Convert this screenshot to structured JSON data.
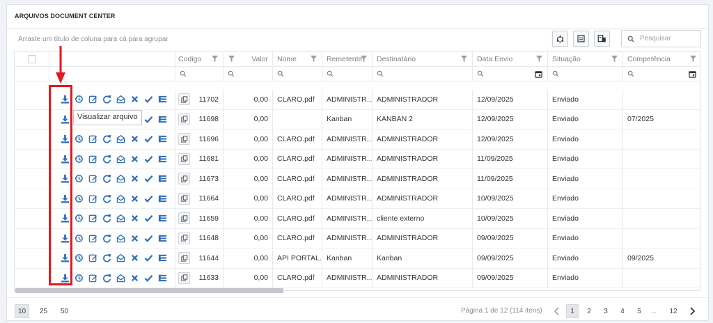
{
  "panel": {
    "title": "ARQUIVOS DOCUMENT CENTER",
    "group_hint": "Arraste um título de coluna para cá para agrupar"
  },
  "toolbar": {
    "buttons": [
      {
        "name": "refresh-icon"
      },
      {
        "name": "export-excel-icon"
      },
      {
        "name": "column-chooser-icon"
      }
    ],
    "search_placeholder": "Pesquisar",
    "search_value": ""
  },
  "columns": {
    "codigo": "Codigo",
    "valor": "Valor",
    "nome": "Nome",
    "remetente": "Remetente",
    "destinatario": "Destinatário",
    "data_envio": "Data Envio",
    "situacao": "Situação",
    "competencia": "Competência"
  },
  "action_icons": [
    "download-icon",
    "history-icon",
    "edit-icon",
    "redo-icon",
    "open-mail-icon",
    "cancel-icon",
    "check-icon",
    "details-list-icon"
  ],
  "rows": [
    {
      "codigo": "11702",
      "valor": "0,00",
      "nome": "CLARO.pdf",
      "remetente": "ADMINISTR...",
      "destinatario": "ADMINISTRADOR",
      "data_envio": "12/09/2025",
      "situacao": "Enviado",
      "competencia": ""
    },
    {
      "codigo": "11698",
      "valor": "0,00",
      "nome": "",
      "remetente": "Kanban",
      "destinatario": "KANBAN 2",
      "data_envio": "12/09/2025",
      "situacao": "Enviado",
      "competencia": "07/2025"
    },
    {
      "codigo": "11696",
      "valor": "0,00",
      "nome": "CLARO.pdf",
      "remetente": "ADMINISTR...",
      "destinatario": "ADMINISTRADOR",
      "data_envio": "12/09/2025",
      "situacao": "Enviado",
      "competencia": ""
    },
    {
      "codigo": "11681",
      "valor": "0,00",
      "nome": "CLARO.pdf",
      "remetente": "ADMINISTR...",
      "destinatario": "ADMINISTRADOR",
      "data_envio": "11/09/2025",
      "situacao": "Enviado",
      "competencia": ""
    },
    {
      "codigo": "11673",
      "valor": "0,00",
      "nome": "CLARO.pdf",
      "remetente": "ADMINISTR...",
      "destinatario": "ADMINISTRADOR",
      "data_envio": "11/09/2025",
      "situacao": "Enviado",
      "competencia": ""
    },
    {
      "codigo": "11664",
      "valor": "0,00",
      "nome": "CLARO.pdf",
      "remetente": "ADMINISTR...",
      "destinatario": "ADMINISTRADOR",
      "data_envio": "10/09/2025",
      "situacao": "Enviado",
      "competencia": ""
    },
    {
      "codigo": "11659",
      "valor": "0,00",
      "nome": "CLARO.pdf",
      "remetente": "ADMINISTR...",
      "destinatario": "cliente externo",
      "data_envio": "10/09/2025",
      "situacao": "Enviado",
      "competencia": ""
    },
    {
      "codigo": "11648",
      "valor": "0,00",
      "nome": "CLARO.pdf",
      "remetente": "ADMINISTR...",
      "destinatario": "ADMINISTRADOR",
      "data_envio": "09/09/2025",
      "situacao": "Enviado",
      "competencia": ""
    },
    {
      "codigo": "11644",
      "valor": "0,00",
      "nome": "API PORTAL...",
      "remetente": "Kanban",
      "destinatario": "Kanban",
      "data_envio": "09/09/2025",
      "situacao": "Enviado",
      "competencia": "09/2025"
    },
    {
      "codigo": "11633",
      "valor": "0,00",
      "nome": "CLARO.pdf",
      "remetente": "ADMINISTR...",
      "destinatario": "ADMINISTRADOR",
      "data_envio": "09/09/2025",
      "situacao": "Enviado",
      "competencia": ""
    }
  ],
  "tooltip": "Visualizar arquivo",
  "pager": {
    "page_sizes": [
      "10",
      "25",
      "50"
    ],
    "active_page_size": "10",
    "info": "Página 1 de 12 (114 itens)",
    "pages": [
      "1",
      "2",
      "3",
      "4",
      "5",
      "...",
      "12"
    ],
    "active_page": "1"
  },
  "colors": {
    "accent_icon": "#2f6fb5",
    "highlight": "#e1191c"
  }
}
